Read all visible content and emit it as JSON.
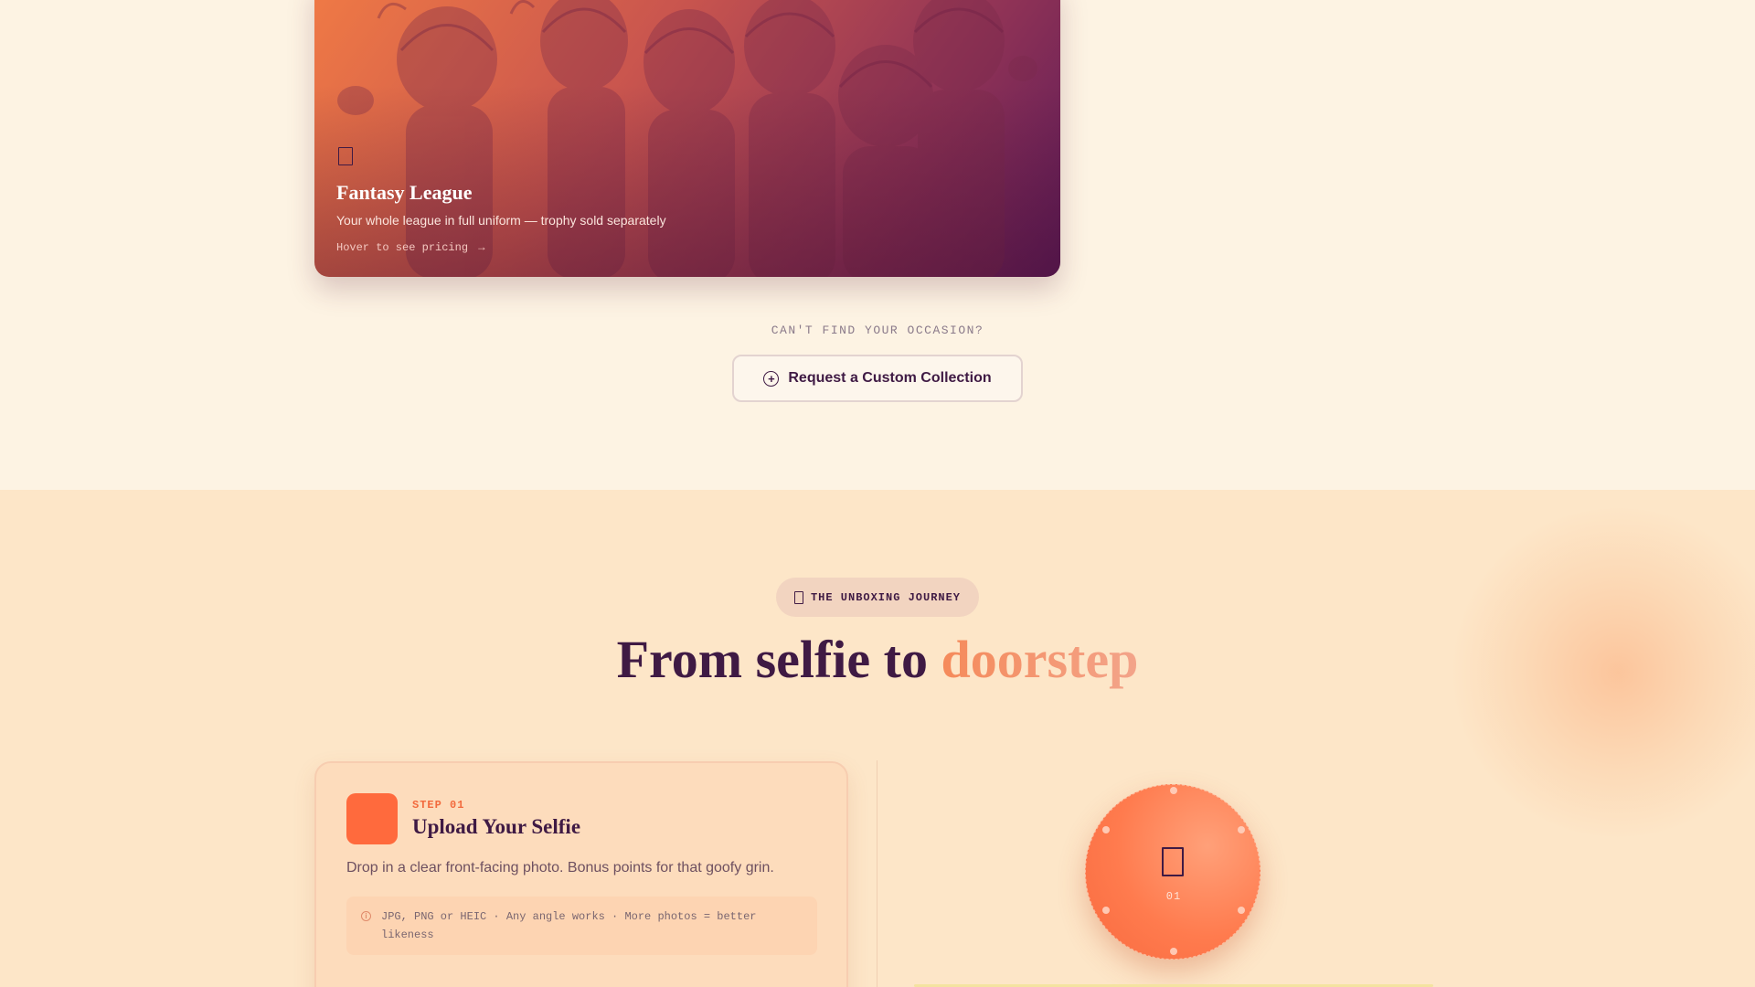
{
  "occasion_card": {
    "icon": "trophy-icon",
    "title": "Fantasy League",
    "description": "Your whole league in full uniform — trophy sold separately",
    "hover_hint": "Hover to see pricing",
    "hover_arrow": "→"
  },
  "custom_request": {
    "prompt": "CAN'T FIND YOUR OCCASION?",
    "button_label": "Request a Custom Collection",
    "button_icon": "plus-circle-icon",
    "button_icon_glyph": "+"
  },
  "journey": {
    "pill_label": "THE UNBOXING JOURNEY",
    "pill_icon": "gift-icon",
    "title_main": "From selfie to",
    "title_accent": "doorstep",
    "steps": [
      {
        "label": "STEP 01",
        "title": "Upload Your Selfie",
        "description": "Drop in a clear front-facing photo. Bonus points for that goofy grin.",
        "note": "JPG, PNG or HEIC · Any angle works · More photos = better likeness",
        "note_icon": "info-icon",
        "note_icon_glyph": "i"
      }
    ],
    "dial": {
      "icon": "camera-icon",
      "number": "01"
    }
  },
  "colors": {
    "page_background": "#fdf3e3",
    "journey_background": "#fde6c8",
    "primary_dark": "#3f1a44",
    "accent_orange": "#ff6a3d",
    "accent_gradient_start": "#f58a5a",
    "accent_gradient_end": "#f3a48a"
  }
}
